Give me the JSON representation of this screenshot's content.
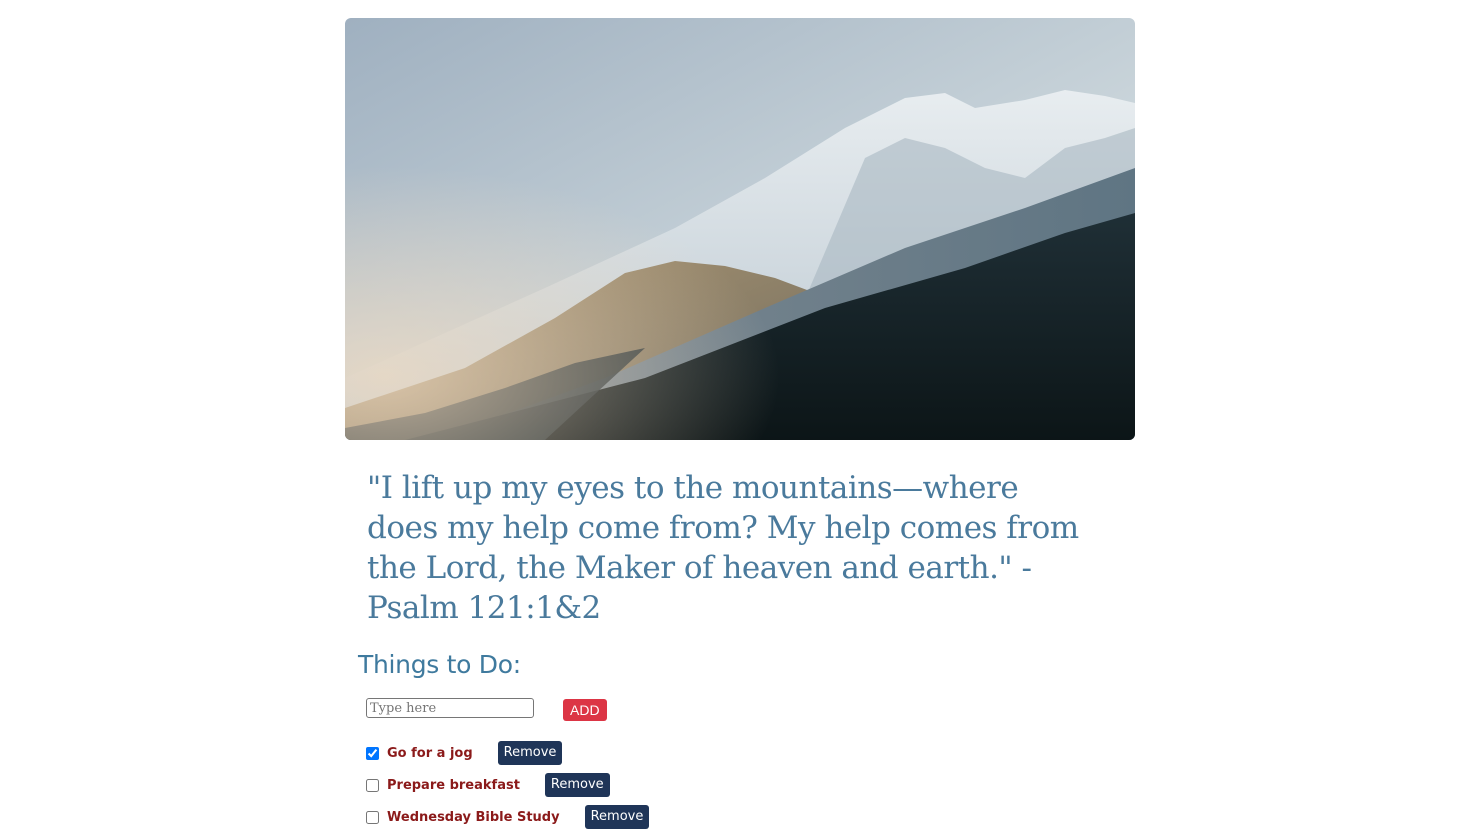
{
  "hero": {
    "image": "snow-capped-mountain-with-forest-photo"
  },
  "quote": {
    "text": "\"I lift up my eyes to the mountains—where does my help come from? My help comes from the Lord, the Maker of heaven and earth.\" -Psalm 121:1&2"
  },
  "todo": {
    "title": "Things to Do:",
    "input_value": "",
    "input_placeholder": "Type here",
    "add_label": "ADD",
    "remove_label": "Remove",
    "items": [
      {
        "label": "Go for a jog",
        "checked": true
      },
      {
        "label": "Prepare breakfast",
        "checked": false
      },
      {
        "label": "Wednesday Bible Study",
        "checked": false
      }
    ]
  },
  "colors": {
    "quote_text": "#4a7a9c",
    "title_text": "#3f7a9e",
    "add_button": "#dc3545",
    "remove_button": "#1f3558",
    "item_text": "#8b1a1a"
  }
}
